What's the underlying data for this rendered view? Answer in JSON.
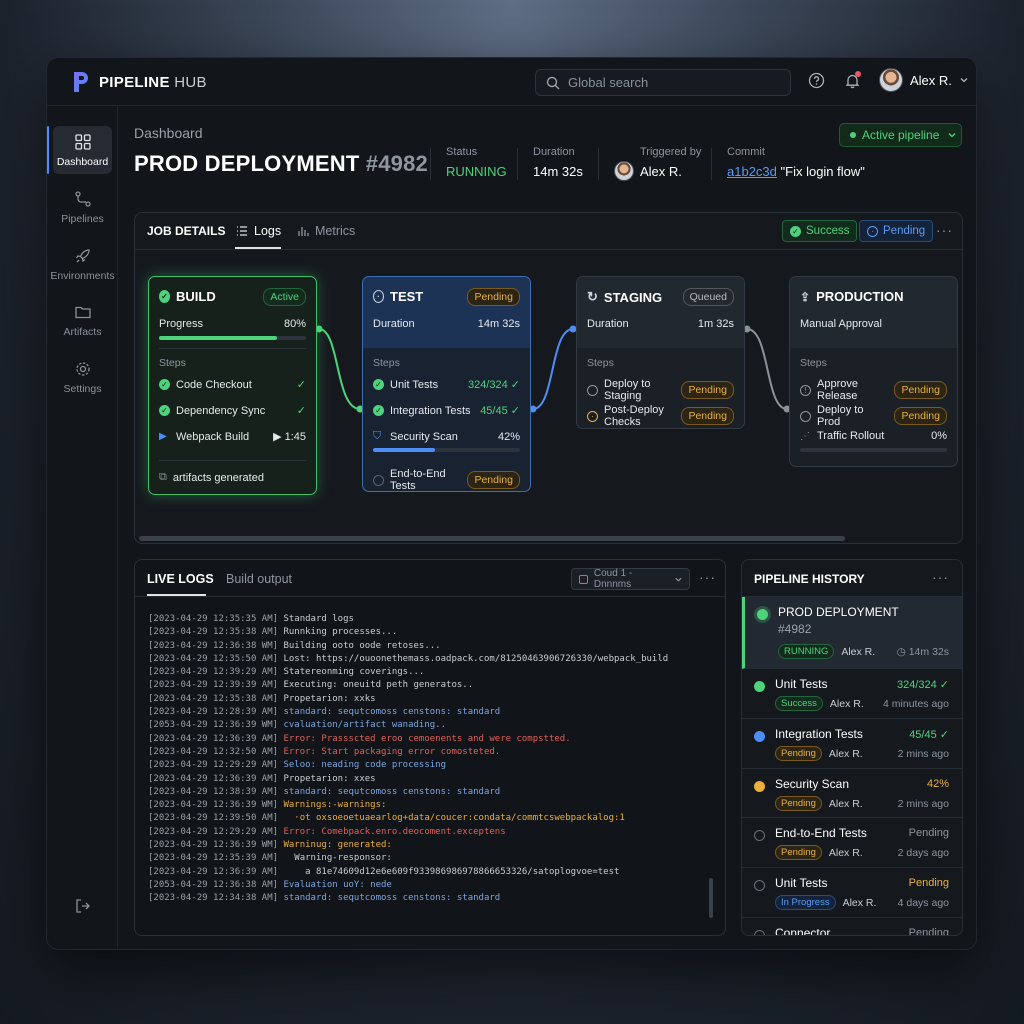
{
  "app": {
    "brand_main": "PIPELINE",
    "brand_sub": "HUB",
    "user_name": "Alex R."
  },
  "search": {
    "placeholder": "Global search"
  },
  "sidebar": {
    "items": [
      {
        "label": "Dashboard",
        "icon": "grid-icon"
      },
      {
        "label": "Pipelines",
        "icon": "pipeline-icon"
      },
      {
        "label": "Environments",
        "icon": "rocket-icon"
      },
      {
        "label": "Artifacts",
        "icon": "folder-icon"
      },
      {
        "label": "Settings",
        "icon": "gear-icon"
      }
    ]
  },
  "header": {
    "breadcrumb": "Dashboard",
    "title": "PROD DEPLOYMENT",
    "number": "#4982",
    "status_label": "Status",
    "status_value": "RUNNING",
    "duration_label": "Duration",
    "duration_value": "14m 32s",
    "triggered_label": "Triggered by",
    "triggered_value": "Alex R.",
    "commit_label": "Commit",
    "commit_hash": "a1b2c3d",
    "commit_msg": "\"Fix login flow\"",
    "active_pill": "Active pipeline"
  },
  "job": {
    "title": "JOB DETAILS",
    "tab_logs": "Logs",
    "tab_metrics": "Metrics",
    "chip_success": "Success",
    "chip_pending": "Pending",
    "stages": {
      "build": {
        "name": "BUILD",
        "badge": "Active",
        "progress_label": "Progress",
        "progress_value": "80%",
        "progress": 0.8,
        "steps_label": "Steps",
        "steps": [
          {
            "name": "Code Checkout",
            "right": "✓"
          },
          {
            "name": "Dependency Sync",
            "right": "✓"
          },
          {
            "name": "Webpack Build",
            "right": "▶ 1:45"
          }
        ],
        "footer": "artifacts generated"
      },
      "test": {
        "name": "TEST",
        "badge": "Pending",
        "duration_label": "Duration",
        "duration_value": "14m 32s",
        "steps_label": "Steps",
        "steps": [
          {
            "name": "Unit Tests",
            "right": "324/324 ✓"
          },
          {
            "name": "Integration Tests",
            "right": "45/45 ✓"
          },
          {
            "name": "Security Scan",
            "right": "42%"
          },
          {
            "name": "End-to-End Tests",
            "right": "Pending"
          }
        ],
        "scan_progress": 0.42
      },
      "staging": {
        "name": "STAGING",
        "badge": "Queued",
        "duration_label": "Duration",
        "duration_value": "1m 32s",
        "steps_label": "Steps",
        "steps": [
          {
            "name": "Deploy to Staging",
            "right": "Pending"
          },
          {
            "name": "Post-Deploy Checks",
            "right": "Pending"
          }
        ]
      },
      "production": {
        "name": "PRODUCTION",
        "subtitle": "Manual Approval",
        "steps_label": "Steps",
        "steps": [
          {
            "name": "Approve Release",
            "right": "Pending"
          },
          {
            "name": "Deploy to Prod",
            "right": "Pending"
          },
          {
            "name": "Traffic Rollout",
            "right": "0%"
          }
        ],
        "rollout_progress": 0.0
      }
    }
  },
  "logs": {
    "tab_live": "LIVE LOGS",
    "tab_build": "Build output",
    "filter": "Coud 1 -Dnnnms",
    "lines": [
      {
        "ts": "[2023-04-29 12:35:35 AM]",
        "msg": "Standard logs",
        "color": "#c9ced6"
      },
      {
        "ts": "[2023-04-29 12:35:38 AM]",
        "msg": "Runnking processes...",
        "color": "#c9ced6"
      },
      {
        "ts": "[2023-04-29 12:36:38 WM]",
        "msg": "Building ooto oode retoses...",
        "color": "#c9ced6"
      },
      {
        "ts": "[2023-04-29 12:35:50 AM]",
        "msg": "Lost: https://ouoonethemass.oadpack.com/81250463906726330/webpack_build",
        "color": "#c9ced6"
      },
      {
        "ts": "[2023-04-29 12:39:29 AM]",
        "msg": "Statereonming coverings...",
        "color": "#c9ced6"
      },
      {
        "ts": "[2023-04-29 12:39:39 AM]",
        "msg": "Executing: oneuitd peth generatos..",
        "color": "#c9ced6"
      },
      {
        "ts": "[2023-04-29 12:35:38 AM]",
        "msg": "Propetarion: xxks",
        "color": "#c9ced6"
      },
      {
        "ts": "[2023-04-29 12:28:39 AM]",
        "msg": "standard: sequtcomoss censtons: standard",
        "color": "#7ea6e0"
      },
      {
        "ts": "[2053-04-29 12:36:39 WM]",
        "msg": "cvaluation/artifact wanading..",
        "color": "#7ea6e0"
      },
      {
        "ts": "[2023-04-29 12:36:39 AM]",
        "msg": "Error: Prassscted eroo cemoenents and were compstted.",
        "color": "#e0605a"
      },
      {
        "ts": "[2023-04-29 12:32:50 AM]",
        "msg": "Error: Start packaging error comosteted.",
        "color": "#e0605a"
      },
      {
        "ts": "[2023-04-29 12:29:29 AM]",
        "msg": "Seloo: neading code processing",
        "color": "#7ea6e0"
      },
      {
        "ts": "[2023-04-29 12:36:39 AM]",
        "msg": "Propetarion: xxes",
        "color": "#c9ced6"
      },
      {
        "ts": "[2023-04-29 12:38:39 AM]",
        "msg": "standard: sequtcomoss censtons: standard",
        "color": "#7ea6e0"
      },
      {
        "ts": "[2023-04-29 12:36:39 WM]",
        "msg": "Warnings:-warnings:",
        "color": "#e9b13b"
      },
      {
        "ts": "[2023-04-29 12:39:50 AM]",
        "msg": "  ·ot oxsoeoetuaearlog+data/coucer:condata/commtcswebpackalog:1",
        "color": "#e9b13b"
      },
      {
        "ts": "[2023-04-29 12:29:29 AM]",
        "msg": "Error: Comebpack.enro.deocoment.exceptens",
        "color": "#e0605a"
      },
      {
        "ts": "[2023-04-29 12:36:39 WM]",
        "msg": "Warninug: generated:",
        "color": "#e9b13b"
      },
      {
        "ts": "[2023-04-29 12:35:39 AM]",
        "msg": "  Warning-responsor:",
        "color": "#c9ced6"
      },
      {
        "ts": "[2023-04-29 12:36:39 AM]",
        "msg": "    a 81e74609d12e6e609f933986986978866653326/satoplogvoe=test",
        "color": "#c9ced6"
      },
      {
        "ts": "[2053-04-29 12:36:38 AM]",
        "msg": "Evaluation uoY: nede",
        "color": "#7ea6e0"
      },
      {
        "ts": "[2023-04-29 12:34:38 AM]",
        "msg": "standard: sequtcomoss censtons: standard",
        "color": "#7ea6e0"
      }
    ]
  },
  "history": {
    "title": "PIPELINE HISTORY",
    "items": [
      {
        "name": "PROD DEPLOYMENT",
        "number": "#4982",
        "badge": "RUNNING",
        "user": "Alex R.",
        "time": "14m 32s",
        "status": "",
        "status_color": "#4cd37b",
        "icon_color": "#4cd37b"
      },
      {
        "name": "Unit Tests",
        "badge": "Success",
        "user": "Alex R.",
        "time": "4 minutes ago",
        "status": "324/324 ✓",
        "status_color": "#4cd37b",
        "icon_color": "#4cd37b"
      },
      {
        "name": "Integration Tests",
        "badge": "Pending",
        "user": "Alex R.",
        "time": "2 mins ago",
        "status": "45/45 ✓",
        "status_color": "#4cd37b",
        "icon_color": "#4e8df5"
      },
      {
        "name": "Security Scan",
        "badge": "Pending",
        "user": "Alex R.",
        "time": "2 mins ago",
        "status": "42%",
        "status_color": "#e9b13b",
        "icon_color": "#e9b13b"
      },
      {
        "name": "End-to-End Tests",
        "badge": "Pending",
        "user": "Alex R.",
        "time": "2 days ago",
        "status": "Pending",
        "status_color": "#8e95a0",
        "icon_color": "#5c636d"
      },
      {
        "name": "Unit Tests",
        "badge": "In Progress",
        "user": "Alex R.",
        "time": "4 days ago",
        "status": "Pending",
        "status_color": "#e9b13b",
        "icon_color": "#5c636d"
      },
      {
        "name": "Connector",
        "status": "Pending",
        "status_color": "#8e95a0",
        "icon_color": "#5c636d"
      }
    ]
  },
  "colors": {
    "accent": "#4e8df5",
    "success": "#4cd37b",
    "warning": "#e9b13b",
    "error": "#e0605a"
  }
}
